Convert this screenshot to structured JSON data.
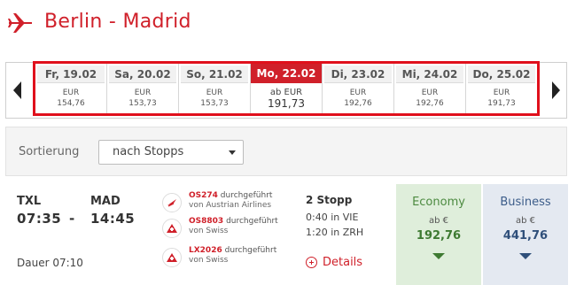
{
  "route": {
    "title": "Berlin - Madrid"
  },
  "dates": [
    {
      "day": "Fr, 19.02",
      "currency": "EUR",
      "price": "154,76"
    },
    {
      "day": "Sa, 20.02",
      "currency": "EUR",
      "price": "153,73"
    },
    {
      "day": "So, 21.02",
      "currency": "EUR",
      "price": "153,73"
    },
    {
      "day": "Mo, 22.02",
      "currency": "ab EUR",
      "price": "191,73"
    },
    {
      "day": "Di, 23.02",
      "currency": "EUR",
      "price": "192,76"
    },
    {
      "day": "Mi, 24.02",
      "currency": "EUR",
      "price": "192,76"
    },
    {
      "day": "Do, 25.02",
      "currency": "EUR",
      "price": "191,73"
    }
  ],
  "sort": {
    "label": "Sortierung",
    "selected": "nach Stopps"
  },
  "flight": {
    "origin": "TXL",
    "destination": "MAD",
    "departure": "07:35",
    "separator": "-",
    "arrival": "14:45",
    "duration": "Dauer 07:10",
    "legs": [
      {
        "number": "OS274",
        "suffix": "durchgeführt",
        "operator": "von Austrian Airlines",
        "icon": "austrian-logo-icon"
      },
      {
        "number": "OS8803",
        "suffix": "durchgeführt",
        "operator": "von Swiss",
        "icon": "swiss-logo-icon"
      },
      {
        "number": "LX2026",
        "suffix": "durchgeführt",
        "operator": "von Swiss",
        "icon": "swiss-logo-icon"
      }
    ],
    "stops": "2 Stopp",
    "layovers": [
      "0:40 in VIE",
      "1:20 in ZRH"
    ],
    "details": "Details"
  },
  "fares": {
    "economy": {
      "class": "Economy",
      "from": "ab €",
      "price": "192,76",
      "color": "#3e7a32"
    },
    "business": {
      "class": "Business",
      "from": "ab €",
      "price": "441,76",
      "color": "#2f4f7a"
    }
  },
  "colors": {
    "brand": "#d0202a",
    "highlight_frame": "#e0101c"
  }
}
